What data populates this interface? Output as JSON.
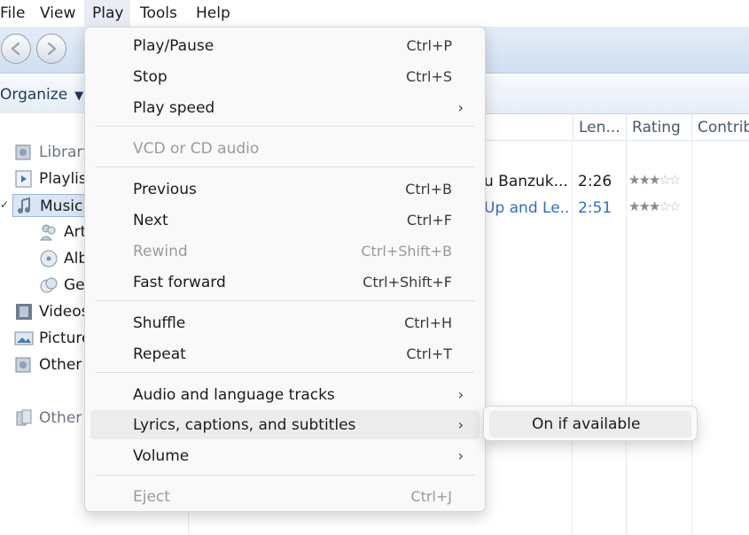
{
  "menubar": {
    "items": [
      "File",
      "View",
      "Play",
      "Tools",
      "Help"
    ]
  },
  "toolbar": {
    "organize_label": "Organize",
    "back_icon": "back-arrow-icon",
    "forward_icon": "forward-arrow-icon"
  },
  "navpane": {
    "items": [
      "Library",
      "Playlis",
      "Music",
      "Art",
      "Alb",
      "Ge",
      "Videos",
      "Picture",
      "Other",
      "Other"
    ],
    "expander": "✓"
  },
  "grid": {
    "columns": [
      "Len...",
      "Rating",
      "Contrib"
    ],
    "rows": [
      {
        "title": "u Banzuk...",
        "length": "2:26",
        "rating": 3
      },
      {
        "title": "Up and Le...",
        "length": "2:51",
        "rating": 3
      }
    ]
  },
  "play_menu": {
    "items": [
      {
        "label": "Play/Pause",
        "shortcut": "Ctrl+P"
      },
      {
        "label": "Stop",
        "shortcut": "Ctrl+S"
      },
      {
        "label": "Play speed",
        "submenu": true
      },
      {
        "label": "VCD or CD audio",
        "disabled": true
      },
      {
        "label": "Previous",
        "shortcut": "Ctrl+B"
      },
      {
        "label": "Next",
        "shortcut": "Ctrl+F"
      },
      {
        "label": "Rewind",
        "shortcut": "Ctrl+Shift+B",
        "disabled": true
      },
      {
        "label": "Fast forward",
        "shortcut": "Ctrl+Shift+F"
      },
      {
        "label": "Shuffle",
        "shortcut": "Ctrl+H"
      },
      {
        "label": "Repeat",
        "shortcut": "Ctrl+T"
      },
      {
        "label": "Audio and language tracks",
        "submenu": true
      },
      {
        "label": "Lyrics, captions, and subtitles",
        "submenu": true,
        "highlighted": true
      },
      {
        "label": "Volume",
        "submenu": true
      },
      {
        "label": "Eject",
        "shortcut": "Ctrl+J",
        "disabled": true
      }
    ],
    "submenu_arrow": "›"
  },
  "submenu": {
    "items": [
      "On if available"
    ]
  },
  "colors": {
    "menu_bg": "#f9f9f9",
    "highlight": "#ececec",
    "disabled_text": "#9a9a9a",
    "link_blue": "#2e6fc4"
  }
}
